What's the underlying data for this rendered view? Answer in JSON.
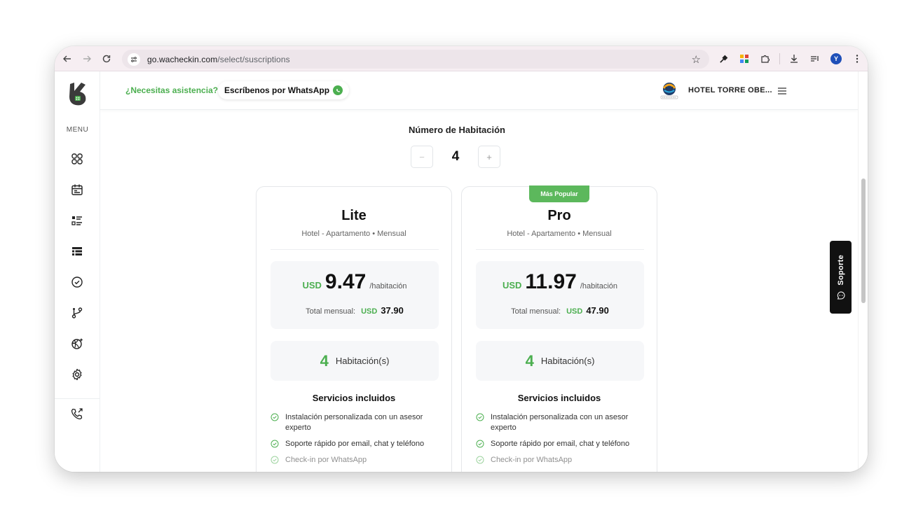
{
  "browser": {
    "url_host": "go.wacheckin.com",
    "url_path": "/select/suscriptions",
    "profile_initial": "Y"
  },
  "header": {
    "help_question": "¿Necesitas asistencia?",
    "help_link": "Escríbenos por WhatsApp",
    "hotel_name": "HOTEL TORRE OBE..."
  },
  "sidebar": {
    "menu_label": "MENU",
    "items": [
      "dashboard-icon",
      "calendar-icon",
      "list-icon",
      "table-icon",
      "check-circle-icon",
      "branch-icon",
      "sparkle-ball-icon",
      "gear-icon",
      "phone-call-icon"
    ]
  },
  "rooms": {
    "title": "Número de Habitación",
    "value": "4",
    "minus": "−",
    "plus": "+"
  },
  "plans": [
    {
      "name": "Lite",
      "subtitle": "Hotel - Apartamento • Mensual",
      "currency": "USD",
      "price": "9.47",
      "per": "/habitación",
      "total_label": "Total mensual:",
      "total_currency": "USD",
      "total": "37.90",
      "rooms_count": "4",
      "rooms_label": "Habitación(s)",
      "services_title": "Servicios incluidos",
      "services": [
        "Instalación personalizada con un asesor experto",
        "Soporte rápido por email, chat y teléfono",
        "Check-in por WhatsApp"
      ]
    },
    {
      "badge": "Más Popular",
      "name": "Pro",
      "subtitle": "Hotel - Apartamento • Mensual",
      "currency": "USD",
      "price": "11.97",
      "per": "/habitación",
      "total_label": "Total mensual:",
      "total_currency": "USD",
      "total": "47.90",
      "rooms_count": "4",
      "rooms_label": "Habitación(s)",
      "services_title": "Servicios incluidos",
      "services": [
        "Instalación personalizada con un asesor experto",
        "Soporte rápido por email, chat y teléfono",
        "Check-in por WhatsApp"
      ]
    }
  ],
  "support": {
    "label": "Soporte"
  },
  "colors": {
    "accent": "#4caf50",
    "badge": "#5cb85c",
    "support_bg": "#111111"
  }
}
